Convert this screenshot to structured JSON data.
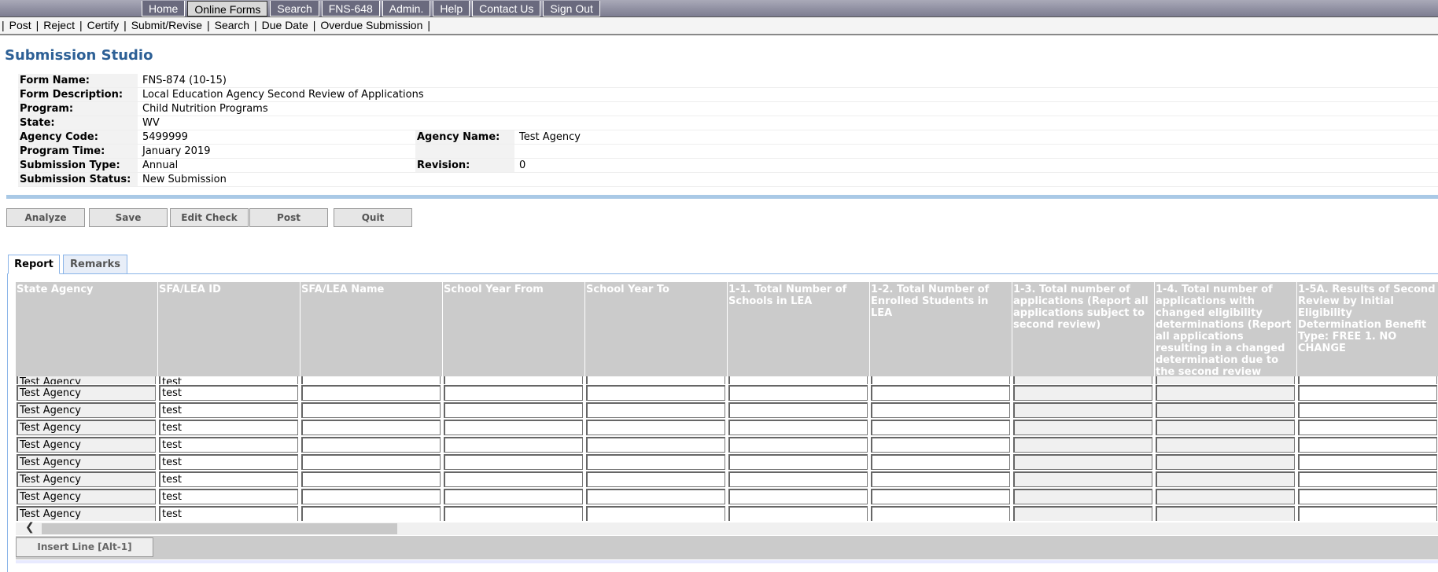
{
  "topnav": [
    "Home",
    "Online Forms",
    "Search",
    "FNS-648",
    "Admin.",
    "Help",
    "Contact Us",
    "Sign Out"
  ],
  "topnav_active": "Online Forms",
  "subnav": [
    "Post",
    "Reject",
    "Certify",
    "Submit/Revise",
    "Search",
    "Due Date",
    "Overdue Submission"
  ],
  "title": "Submission Studio",
  "info": {
    "form_name_label": "Form Name:",
    "form_name": "FNS-874 (10-15)",
    "form_desc_label": "Form Description:",
    "form_desc": "Local Education Agency Second Review of Applications",
    "program_label": "Program:",
    "program": "Child Nutrition Programs",
    "state_label": "State:",
    "state": "WV",
    "agency_code_label": "Agency Code:",
    "agency_code": "5499999",
    "agency_name_label": "Agency Name:",
    "agency_name": "Test Agency",
    "program_time_label": "Program Time:",
    "program_time": "January 2019",
    "sub_type_label": "Submission Type:",
    "sub_type": "Annual",
    "revision_label": "Revision:",
    "revision": "0",
    "status_label": "Submission Status:",
    "status": "New Submission"
  },
  "actions": [
    "Analyze",
    "Save",
    "Edit Check",
    "Post",
    "Quit"
  ],
  "tabs": {
    "report": "Report",
    "remarks": "Remarks"
  },
  "columns": [
    "State Agency",
    "SFA/LEA ID",
    "SFA/LEA Name",
    "School Year From",
    "School Year To",
    "1-1. Total Number of Schools in LEA",
    "1-2. Total Number of Enrolled Students in LEA",
    "1-3. Total number of applications (Report all applications subject to second review)",
    "1-4. Total number of applications with changed eligibility determinations (Report all applications resulting in a changed determination due to the second review process)",
    "1-5A. Results of Second Review by Initial Eligibility Determination Benefit Type: FREE 1. NO CHANGE"
  ],
  "disabled_columns": [
    0,
    7,
    8
  ],
  "rows": [
    [
      "Test Agency",
      "test",
      "",
      "",
      "",
      "",
      "",
      "",
      "",
      ""
    ],
    [
      "Test Agency",
      "test",
      "",
      "",
      "",
      "",
      "",
      "",
      "",
      ""
    ],
    [
      "Test Agency",
      "test",
      "",
      "",
      "",
      "",
      "",
      "",
      "",
      ""
    ],
    [
      "Test Agency",
      "test",
      "",
      "",
      "",
      "",
      "",
      "",
      "",
      ""
    ],
    [
      "Test Agency",
      "test",
      "",
      "",
      "",
      "",
      "",
      "",
      "",
      ""
    ],
    [
      "Test Agency",
      "test",
      "",
      "",
      "",
      "",
      "",
      "",
      "",
      ""
    ],
    [
      "Test Agency",
      "test",
      "",
      "",
      "",
      "",
      "",
      "",
      "",
      ""
    ],
    [
      "Test Agency",
      "test",
      "",
      "",
      "",
      "",
      "",
      "",
      "",
      ""
    ],
    [
      "Test Agency",
      "test",
      "",
      "",
      "",
      "",
      "",
      "",
      "",
      ""
    ]
  ],
  "insert_line": "Insert Line [Alt-1]",
  "colors": {
    "title": "#2d6096",
    "header_bg": "#cbcbcb",
    "tab_border": "#8ab4e8",
    "divider": "#a9c9e6"
  }
}
